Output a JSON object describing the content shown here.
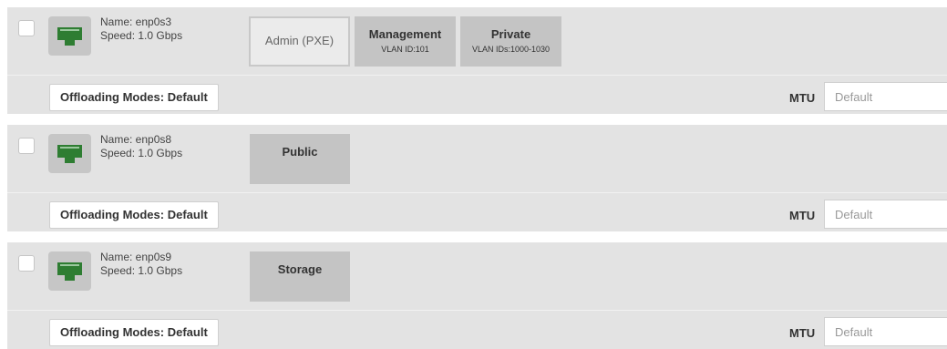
{
  "interfaces": [
    {
      "name": "Name: enp0s3",
      "speed": "Speed: 1.0 Gbps",
      "networks": [
        {
          "title": "Admin (PXE)",
          "sub": "",
          "style": "outlined"
        },
        {
          "title": "Management",
          "sub": "VLAN ID:101",
          "style": "dark"
        },
        {
          "title": "Private",
          "sub": "VLAN IDs:1000-1030",
          "style": "dark"
        }
      ],
      "offloading_label": "Offloading Modes: Default",
      "mtu_label": "MTU",
      "mtu_placeholder": "Default"
    },
    {
      "name": "Name: enp0s8",
      "speed": "Speed: 1.0 Gbps",
      "networks": [
        {
          "title": "Public",
          "sub": "",
          "style": "dark"
        }
      ],
      "offloading_label": "Offloading Modes: Default",
      "mtu_label": "MTU",
      "mtu_placeholder": "Default"
    },
    {
      "name": "Name: enp0s9",
      "speed": "Speed: 1.0 Gbps",
      "networks": [
        {
          "title": "Storage",
          "sub": "",
          "style": "dark"
        }
      ],
      "offloading_label": "Offloading Modes: Default",
      "mtu_label": "MTU",
      "mtu_placeholder": "Default"
    }
  ],
  "colors": {
    "panel_bg": "#e3e3e3",
    "nic_icon": "#2e7d32",
    "network_block": "#c4c4c4"
  },
  "icons": {
    "nic": "ethernet-port-icon"
  }
}
